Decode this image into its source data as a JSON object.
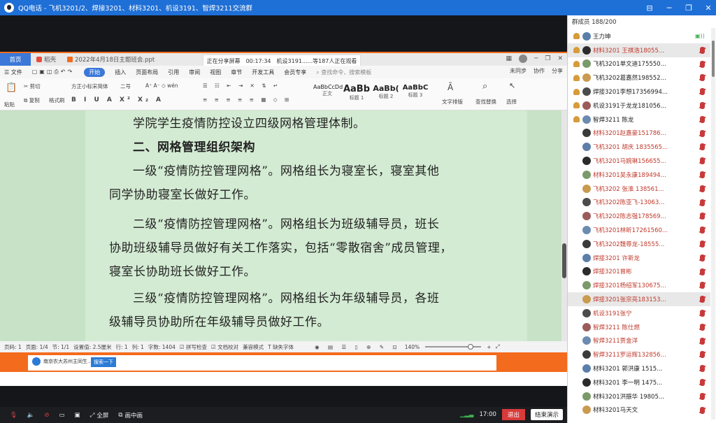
{
  "window": {
    "app": "QQ电话",
    "title": "飞机3201/2、焊接3201、材料3201、机设3191、智焊3211交流群"
  },
  "share": {
    "tabs": [
      {
        "label": "首页",
        "icon": "home-icon"
      },
      {
        "label": "稻壳",
        "icon": "docer-icon"
      },
      {
        "label": "2022年4月18日主题班会.ppt",
        "icon": "ppt-icon"
      }
    ],
    "banner": {
      "status": "正在分享屏幕",
      "time": "00:17:34",
      "viewers": "机设3191......等187人正在观看"
    },
    "menu": [
      "文件",
      "开始",
      "插入",
      "页面布局",
      "引用",
      "审阅",
      "视图",
      "章节",
      "开发工具",
      "会员专享"
    ],
    "active_menu": "开始",
    "search_placeholder": "查找命令、搜索模板",
    "menu_right": [
      "未同步",
      "协作",
      "分享"
    ],
    "ribbon": {
      "paste": "粘贴",
      "cut": "剪切",
      "copy": "复制",
      "format_painter": "格式刷",
      "font": "方正小标宋简体",
      "size": "二号",
      "styles": [
        {
          "preview": "AaBbCcDd",
          "label": "正文"
        },
        {
          "preview": "AaBb",
          "label": "标题 1"
        },
        {
          "preview": "AaBb(",
          "label": "标题 2"
        },
        {
          "preview": "AaBbC",
          "label": "标题 3"
        }
      ],
      "text_layout": "文字排版",
      "find_replace": "查找替换",
      "select": "选择"
    },
    "doc_lines": [
      "学院学生疫情防控设立四级网格管理体制。",
      "二、网格管理组织架构",
      "一级“疫情防控管理网格”。网格组长为寝室长，寝室其他",
      "同学协助寝室长做好工作。",
      "二级“疫情防控管理网格”。网格组长为班级辅导员，班长",
      "协助班级辅导员做好有关工作落实，包括“零散宿舍”成员管理，",
      "寝室长协助班长做好工作。",
      "三级“疫情防控管理网格”。网格组长为年级辅导员，各班",
      "级辅导员协助所在年级辅导员做好工作。"
    ],
    "status": {
      "page_num": "页码: 1",
      "pages": "页面: 1/4",
      "section": "节: 1/1",
      "set_value": "设置值: 2.5厘米",
      "row": "行: 1",
      "col": "列: 1",
      "words": "字数: 1404",
      "spell": "拼写检查",
      "proof": "文档校对",
      "compat": "兼容模式",
      "font_missing": "缺失字体",
      "zoom": "140%"
    },
    "taskbar": {
      "item": "南京农大苏州主同生...",
      "search": "搜索一下"
    }
  },
  "controls": {
    "fullscreen": "全屏",
    "pip": "画中画",
    "time": "17:00",
    "exit": "退出",
    "end": "结束演示"
  },
  "panel": {
    "header": "群成员 188/200",
    "members": [
      {
        "name": "王力坤",
        "color": "#222222",
        "speaking": true
      },
      {
        "name": "材料3201 王祺浩18055...",
        "color": "#c0392b",
        "selected": true
      },
      {
        "name": "飞机3201单文迪175550...",
        "color": "#222222"
      },
      {
        "name": "飞机3202葛嘉然198552...",
        "color": "#222222"
      },
      {
        "name": "焊接3201李想17356994...",
        "color": "#222222"
      },
      {
        "name": "机设3191于龙龙181056...",
        "color": "#222222"
      },
      {
        "name": "智焊3211 陈龙",
        "color": "#222222"
      },
      {
        "name": "材料3201赵嘉豪151786...",
        "color": "#c0392b"
      },
      {
        "name": "飞机3201 胡庆 1835565...",
        "color": "#c0392b"
      },
      {
        "name": "飞机3201马婉琳156655...",
        "color": "#c0392b"
      },
      {
        "name": "材料3201吴永康189494...",
        "color": "#c0392b"
      },
      {
        "name": "飞机3202 张淮 138561...",
        "color": "#c0392b"
      },
      {
        "name": "飞机3202陈亚飞-13063...",
        "color": "#c0392b"
      },
      {
        "name": "飞机3202陈志强178569...",
        "color": "#c0392b"
      },
      {
        "name": "飞机3201林昕17261560...",
        "color": "#c0392b"
      },
      {
        "name": "飞机3202魏尊龙-18555...",
        "color": "#c0392b"
      },
      {
        "name": "焊接3201 许新龙",
        "color": "#c0392b"
      },
      {
        "name": "焊接3201曾彬",
        "color": "#c0392b"
      },
      {
        "name": "焊接3201杨绍军130675...",
        "color": "#c0392b"
      },
      {
        "name": "焊接3201张宗亮183153...",
        "color": "#c0392b",
        "selected": true
      },
      {
        "name": "机设3191张宁",
        "color": "#c0392b"
      },
      {
        "name": "智焊3211 陈仕燃",
        "color": "#c0392b"
      },
      {
        "name": "智焊3211贾金洋",
        "color": "#c0392b"
      },
      {
        "name": "智焊3211罗运辉132856...",
        "color": "#c0392b"
      },
      {
        "name": "材料3201 郭洪康 1515...",
        "color": "#222222"
      },
      {
        "name": "材料3201 李一明 1475...",
        "color": "#222222"
      },
      {
        "name": "材料3201洪振华 19805...",
        "color": "#222222"
      },
      {
        "name": "材料3201马天文",
        "color": "#222222"
      }
    ]
  }
}
